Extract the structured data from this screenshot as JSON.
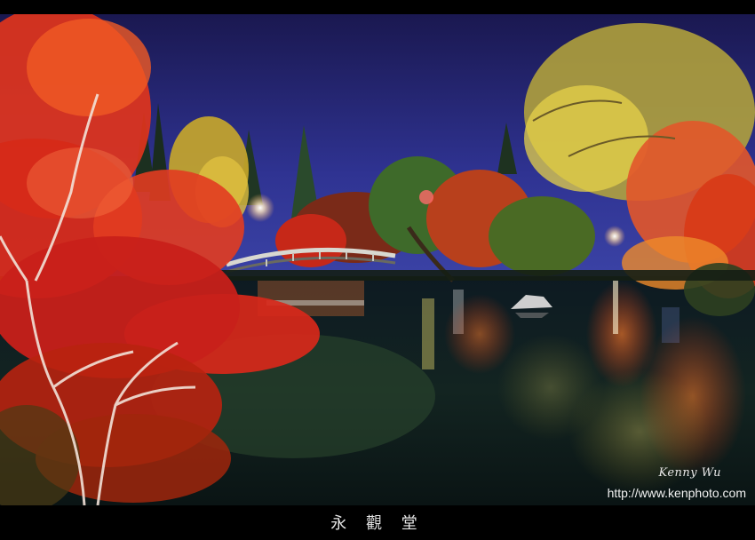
{
  "photo": {
    "caption": "永 觀 堂",
    "watermark_name": "Kenny Wu",
    "watermark_url": "http://www.kenphoto.com"
  },
  "colors": {
    "sky_top": "#1e1a5c",
    "sky_bottom": "#3a3f9e",
    "water": "#0e1a1a",
    "maple_red": "#e8321e",
    "ginkgo_yellow": "#d9c23a"
  }
}
